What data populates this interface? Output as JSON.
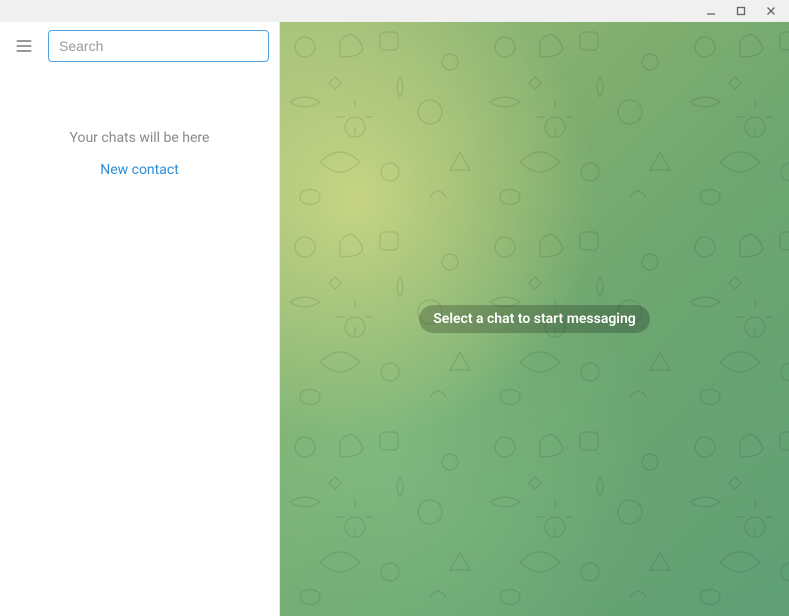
{
  "window": {
    "minimize_name": "minimize-icon",
    "maximize_name": "maximize-icon",
    "close_name": "close-icon"
  },
  "sidebar": {
    "search_placeholder": "Search",
    "empty_text": "Your chats will be here",
    "new_contact_label": "New contact"
  },
  "main": {
    "select_chat_label": "Select a chat to start messaging"
  },
  "colors": {
    "accent": "#4fa3e3",
    "link": "#2b8dd6"
  }
}
